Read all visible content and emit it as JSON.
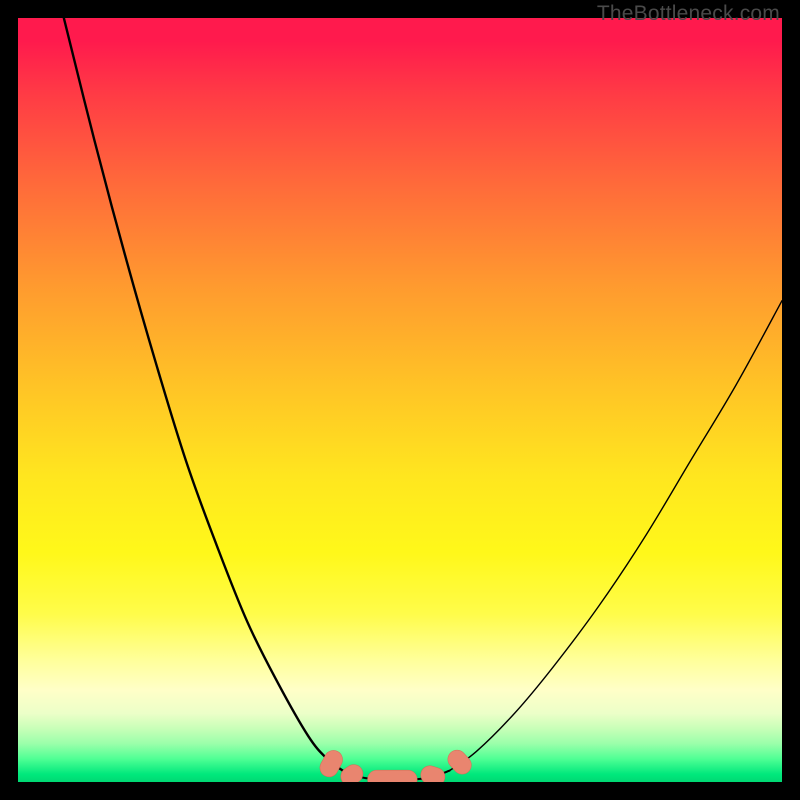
{
  "watermark": {
    "text": "TheBottleneck.com"
  },
  "colors": {
    "frame": "#000000",
    "curve": "#000000",
    "marker": "#e9856f",
    "marker_stroke": "#d96a55"
  },
  "chart_data": {
    "type": "line",
    "title": "",
    "xlabel": "",
    "ylabel": "",
    "xlim": [
      0,
      100
    ],
    "ylim": [
      0,
      100
    ],
    "grid": false,
    "legend": false,
    "series": [
      {
        "name": "left-curve",
        "x": [
          6,
          10,
          14,
          18,
          22,
          26,
          30,
          34,
          38,
          40.5,
          42.5
        ],
        "y": [
          100,
          84,
          69,
          55,
          42,
          31,
          21,
          13,
          6,
          3,
          1.5
        ]
      },
      {
        "name": "valley-floor",
        "x": [
          42.5,
          45,
          48,
          51,
          54,
          56.5
        ],
        "y": [
          1.5,
          0.6,
          0.3,
          0.3,
          0.6,
          1.5
        ]
      },
      {
        "name": "right-curve",
        "x": [
          56.5,
          60,
          65,
          70,
          76,
          82,
          88,
          94,
          100
        ],
        "y": [
          1.5,
          4,
          9,
          15,
          23,
          32,
          42,
          52,
          63
        ]
      }
    ],
    "markers": [
      {
        "shape": "capsule",
        "cx": 41.0,
        "cy": 2.4,
        "angle": -62,
        "len": 3.6,
        "r": 1.2
      },
      {
        "shape": "capsule",
        "cx": 43.7,
        "cy": 0.9,
        "angle": -35,
        "len": 3.0,
        "r": 1.2
      },
      {
        "shape": "capsule",
        "cx": 49.0,
        "cy": 0.35,
        "angle": 0,
        "len": 6.5,
        "r": 1.2
      },
      {
        "shape": "capsule",
        "cx": 54.3,
        "cy": 0.8,
        "angle": 18,
        "len": 3.2,
        "r": 1.2
      },
      {
        "shape": "capsule",
        "cx": 57.8,
        "cy": 2.6,
        "angle": 48,
        "len": 3.4,
        "r": 1.2
      }
    ]
  }
}
